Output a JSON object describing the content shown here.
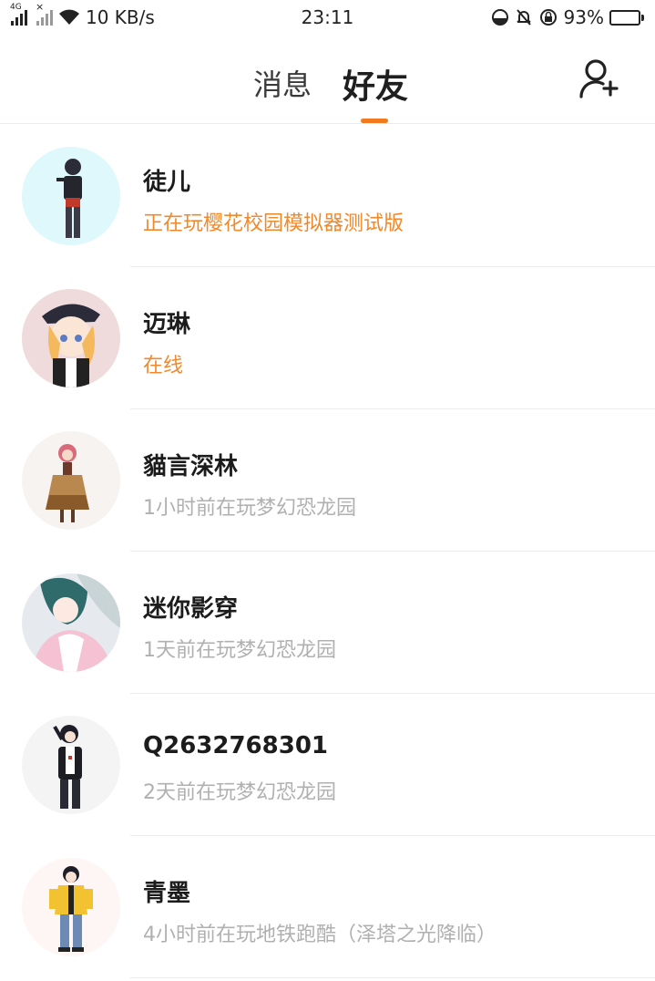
{
  "status_bar": {
    "network_type": "4G",
    "speed": "10 KB/s",
    "time": "23:11",
    "battery": "93%",
    "battery_level": 0.93,
    "icons": [
      "signal-icon",
      "signal-no-sim-icon",
      "wifi-icon",
      "data-saver-icon",
      "bell-muted-icon",
      "rotation-lock-icon",
      "battery-icon"
    ]
  },
  "header": {
    "tabs": [
      {
        "label": "消息",
        "selected": false
      },
      {
        "label": "好友",
        "selected": true
      }
    ],
    "add_friend_icon": "add-person-icon",
    "accent_color": "#f07a1d"
  },
  "friends": [
    {
      "name": "徒儿",
      "status": "正在玩樱花校园模拟器测试版",
      "active": true
    },
    {
      "name": "迈琳",
      "status": "在线",
      "active": true
    },
    {
      "name": "貓言深林",
      "status": "1小时前在玩梦幻恐龙园",
      "active": false
    },
    {
      "name": "迷你影穿",
      "status": "1天前在玩梦幻恐龙园",
      "active": false
    },
    {
      "name": "Q2632768301",
      "status": "2天前在玩梦幻恐龙园",
      "active": false
    },
    {
      "name": "青墨",
      "status": "4小时前在玩地铁跑酷（泽塔之光降临）",
      "active": false
    }
  ],
  "colors": {
    "active_status": "#f0892c",
    "inactive_status": "#b0b0b0"
  }
}
